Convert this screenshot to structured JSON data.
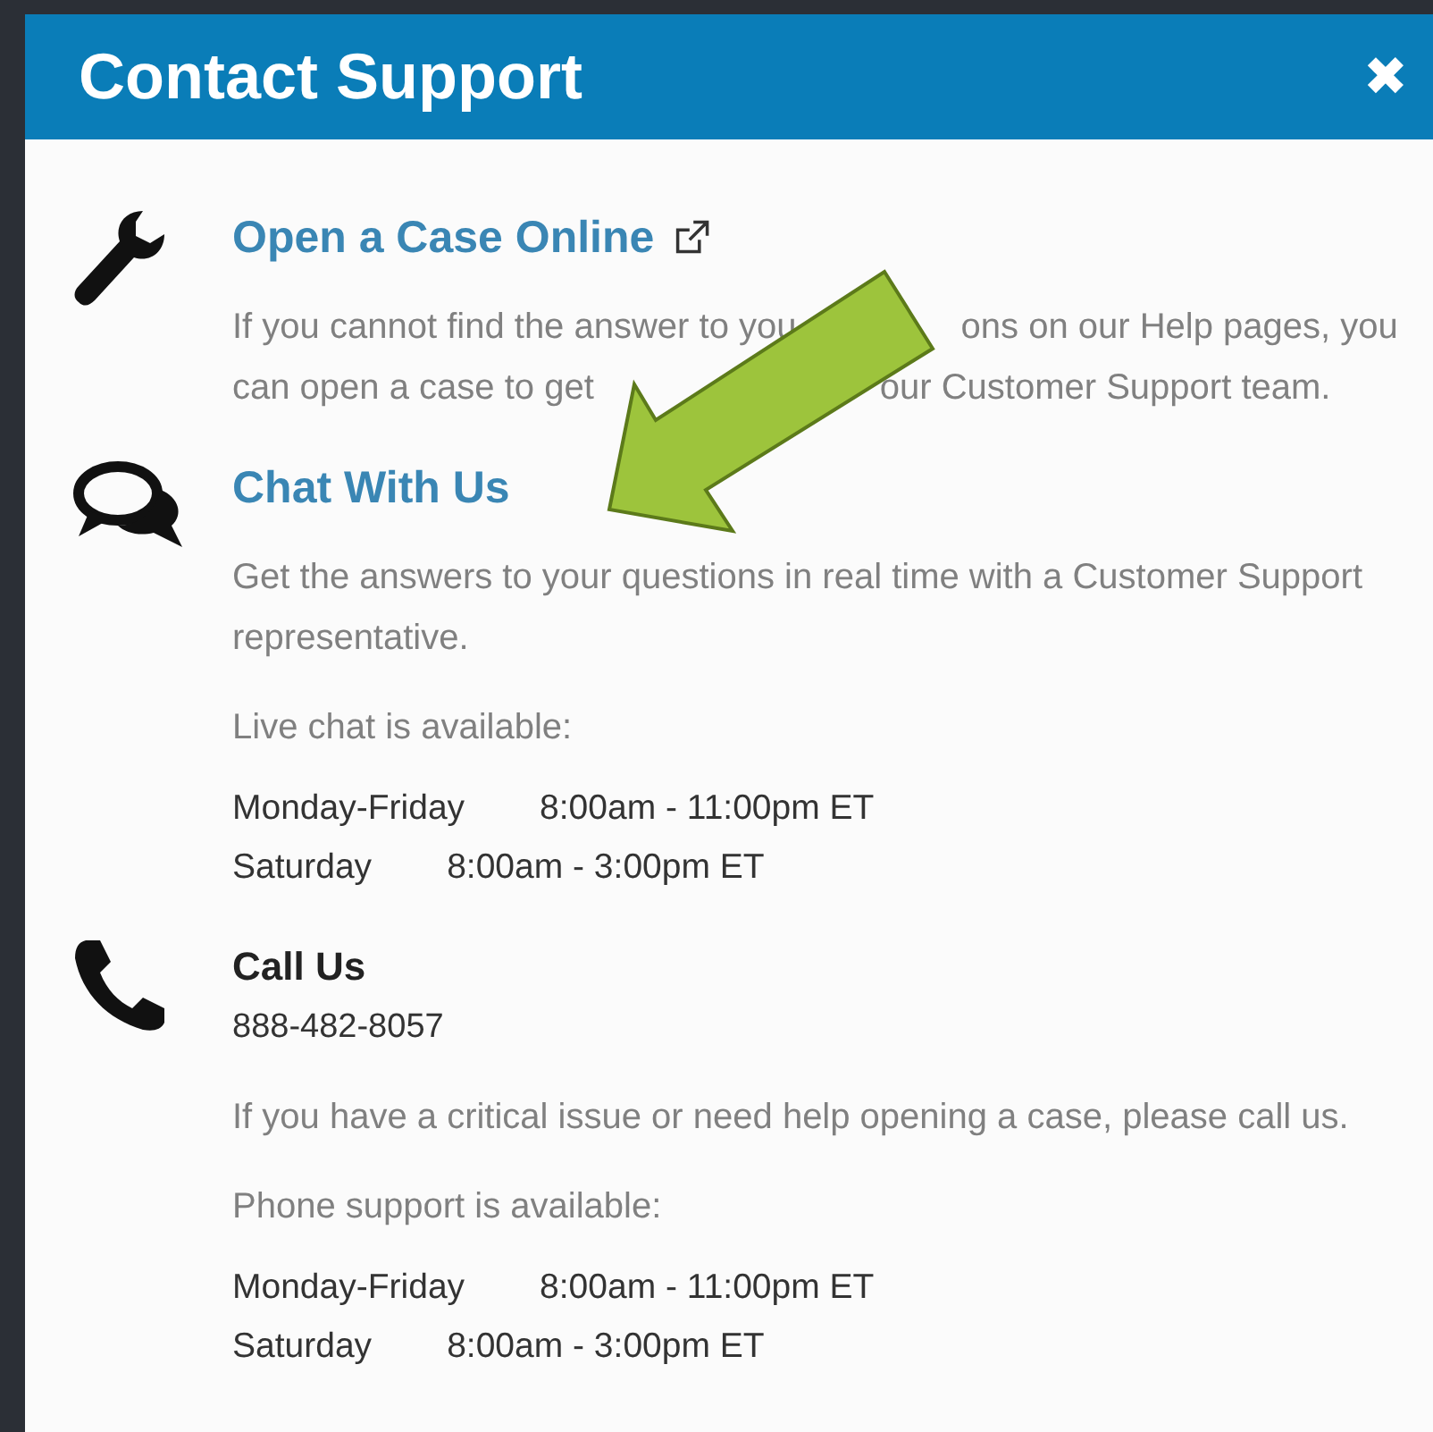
{
  "dialog": {
    "title": "Contact Support",
    "close": "✖"
  },
  "sections": [
    {
      "kind": "link",
      "heading": "Open a Case Online",
      "external": true,
      "paragraphs": [
        {
          "lines": [
            [
              "If you cannot find the answer to you",
              "ons on our Help pages, you"
            ],
            [
              "can open a case to get",
              "our Customer Support team."
            ]
          ]
        }
      ]
    },
    {
      "kind": "link",
      "heading": "Chat With Us",
      "external": false,
      "paragraphs": [
        {
          "lines": [
            [
              "Get the answers to your questions in real time with a Customer Support"
            ],
            [
              "representative."
            ]
          ]
        },
        {
          "lines": [
            [
              "Live chat is available:"
            ]
          ]
        }
      ],
      "schedule": [
        {
          "days": "Monday-Friday",
          "hours": "8:00am - 11:00pm ET"
        },
        {
          "days": "Saturday",
          "hours": "8:00am - 3:00pm ET"
        }
      ]
    },
    {
      "kind": "plain",
      "heading": "Call Us",
      "phone": "888-482-8057",
      "paragraphs": [
        {
          "lines": [
            [
              "If you have a critical issue or need help opening a case, please call us."
            ]
          ]
        },
        {
          "lines": [
            [
              "Phone support is available:"
            ]
          ]
        }
      ],
      "schedule": [
        {
          "days": "Monday-Friday",
          "hours": "8:00am - 11:00pm ET"
        },
        {
          "days": "Saturday",
          "hours": "8:00am - 3:00pm ET"
        }
      ]
    }
  ]
}
